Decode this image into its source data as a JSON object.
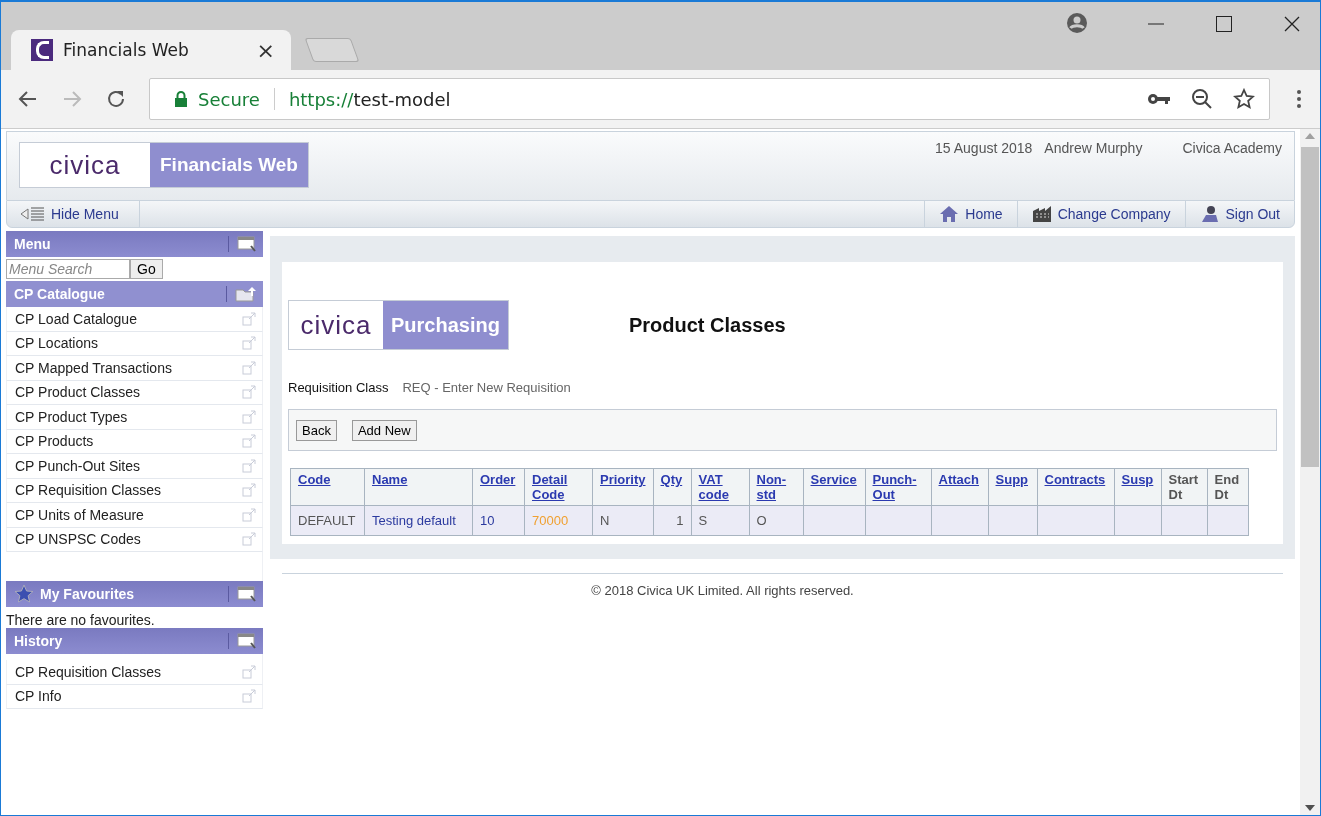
{
  "browser": {
    "tab_title": "Financials Web",
    "tab_close": "×",
    "security": "Secure",
    "url_scheme": "https://",
    "url_host": "test-model"
  },
  "header": {
    "logo_word": "civica",
    "app_name": "Financials Web",
    "date": "15 August 2018",
    "user": "Andrew Murphy",
    "company": "Civica Academy"
  },
  "menu_bar": {
    "hide_menu": "Hide Menu",
    "links": [
      {
        "label": "Home",
        "kind": "home"
      },
      {
        "label": "Change Company",
        "kind": "company"
      },
      {
        "label": "Sign Out",
        "kind": "signout"
      }
    ]
  },
  "sidebar": {
    "menu_title": "Menu",
    "search_placeholder": "Menu Search",
    "go": "Go",
    "catalogue_title": "CP Catalogue",
    "catalogue_items": [
      "CP Load Catalogue",
      "CP Locations",
      "CP Mapped Transactions",
      "CP Product Classes",
      "CP Product Types",
      "CP Products",
      "CP Punch-Out Sites",
      "CP Requisition Classes",
      "CP Units of Measure",
      "CP UNSPSC Codes"
    ],
    "favourites_title": "My Favourites",
    "favourites_empty": "There are no favourites.",
    "history_title": "History",
    "history_items": [
      "CP Requisition Classes",
      "CP Info"
    ]
  },
  "content": {
    "logo_word": "civica",
    "module": "Purchasing",
    "title": "Product Classes",
    "field_label": "Requisition Class",
    "field_value": "REQ - Enter New Requisition",
    "buttons": [
      "Back",
      "Add New"
    ],
    "table": {
      "columns": [
        {
          "label": "Code",
          "sortable": true
        },
        {
          "label": "Name",
          "sortable": true
        },
        {
          "label": "Order",
          "sortable": true
        },
        {
          "label": "Detail Code",
          "sortable": true
        },
        {
          "label": "Priority",
          "sortable": true
        },
        {
          "label": "Qty",
          "sortable": true
        },
        {
          "label": "VAT code",
          "sortable": true
        },
        {
          "label": "Non-std",
          "sortable": true
        },
        {
          "label": "Service",
          "sortable": true
        },
        {
          "label": "Punch-Out",
          "sortable": true
        },
        {
          "label": "Attach",
          "sortable": true
        },
        {
          "label": "Supp",
          "sortable": true
        },
        {
          "label": "Contracts",
          "sortable": true
        },
        {
          "label": "Susp",
          "sortable": true
        },
        {
          "label": "Start Dt",
          "sortable": false
        },
        {
          "label": "End Dt",
          "sortable": false
        }
      ],
      "rows": [
        [
          {
            "text": "DEFAULT",
            "kind": "muted"
          },
          {
            "text": "Testing default",
            "kind": "link"
          },
          {
            "text": "10",
            "kind": "link"
          },
          {
            "text": "70000",
            "kind": "code"
          },
          {
            "text": "N",
            "kind": "muted"
          },
          {
            "text": "1",
            "kind": "number"
          },
          {
            "text": "S",
            "kind": "muted"
          },
          {
            "text": "O",
            "kind": "muted"
          },
          null,
          null,
          null,
          null,
          null,
          null,
          null,
          null
        ]
      ]
    }
  },
  "footer": "© 2018 Civica UK Limited. All rights reserved."
}
